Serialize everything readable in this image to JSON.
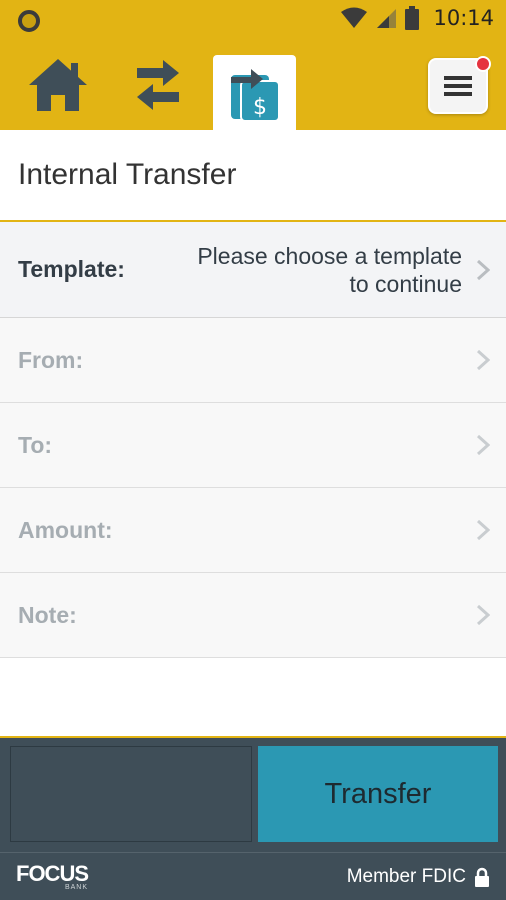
{
  "status_bar": {
    "time": "10:14"
  },
  "nav": {
    "items": [
      {
        "icon": "home-icon"
      },
      {
        "icon": "swap-arrows-icon"
      },
      {
        "icon": "transfer-money-icon",
        "active": true
      },
      {
        "icon": "menu-icon",
        "has_notification": true
      }
    ]
  },
  "page": {
    "title": "Internal Transfer"
  },
  "form": {
    "template": {
      "label": "Template:",
      "value_line1": "Please choose a template",
      "value_line2": "to continue"
    },
    "from": {
      "label": "From:",
      "value": ""
    },
    "to": {
      "label": "To:",
      "value": ""
    },
    "amount": {
      "label": "Amount:",
      "value": ""
    },
    "note": {
      "label": "Note:",
      "value": ""
    }
  },
  "actions": {
    "transfer_label": "Transfer"
  },
  "footer": {
    "logo_main": "FOCUS",
    "logo_sub": "BANK",
    "fdic_text": "Member FDIC"
  },
  "colors": {
    "brand_yellow": "#e2b414",
    "dark_slate": "#3f4e58",
    "accent_teal": "#2b98b3",
    "notification_red": "#e5333f"
  }
}
